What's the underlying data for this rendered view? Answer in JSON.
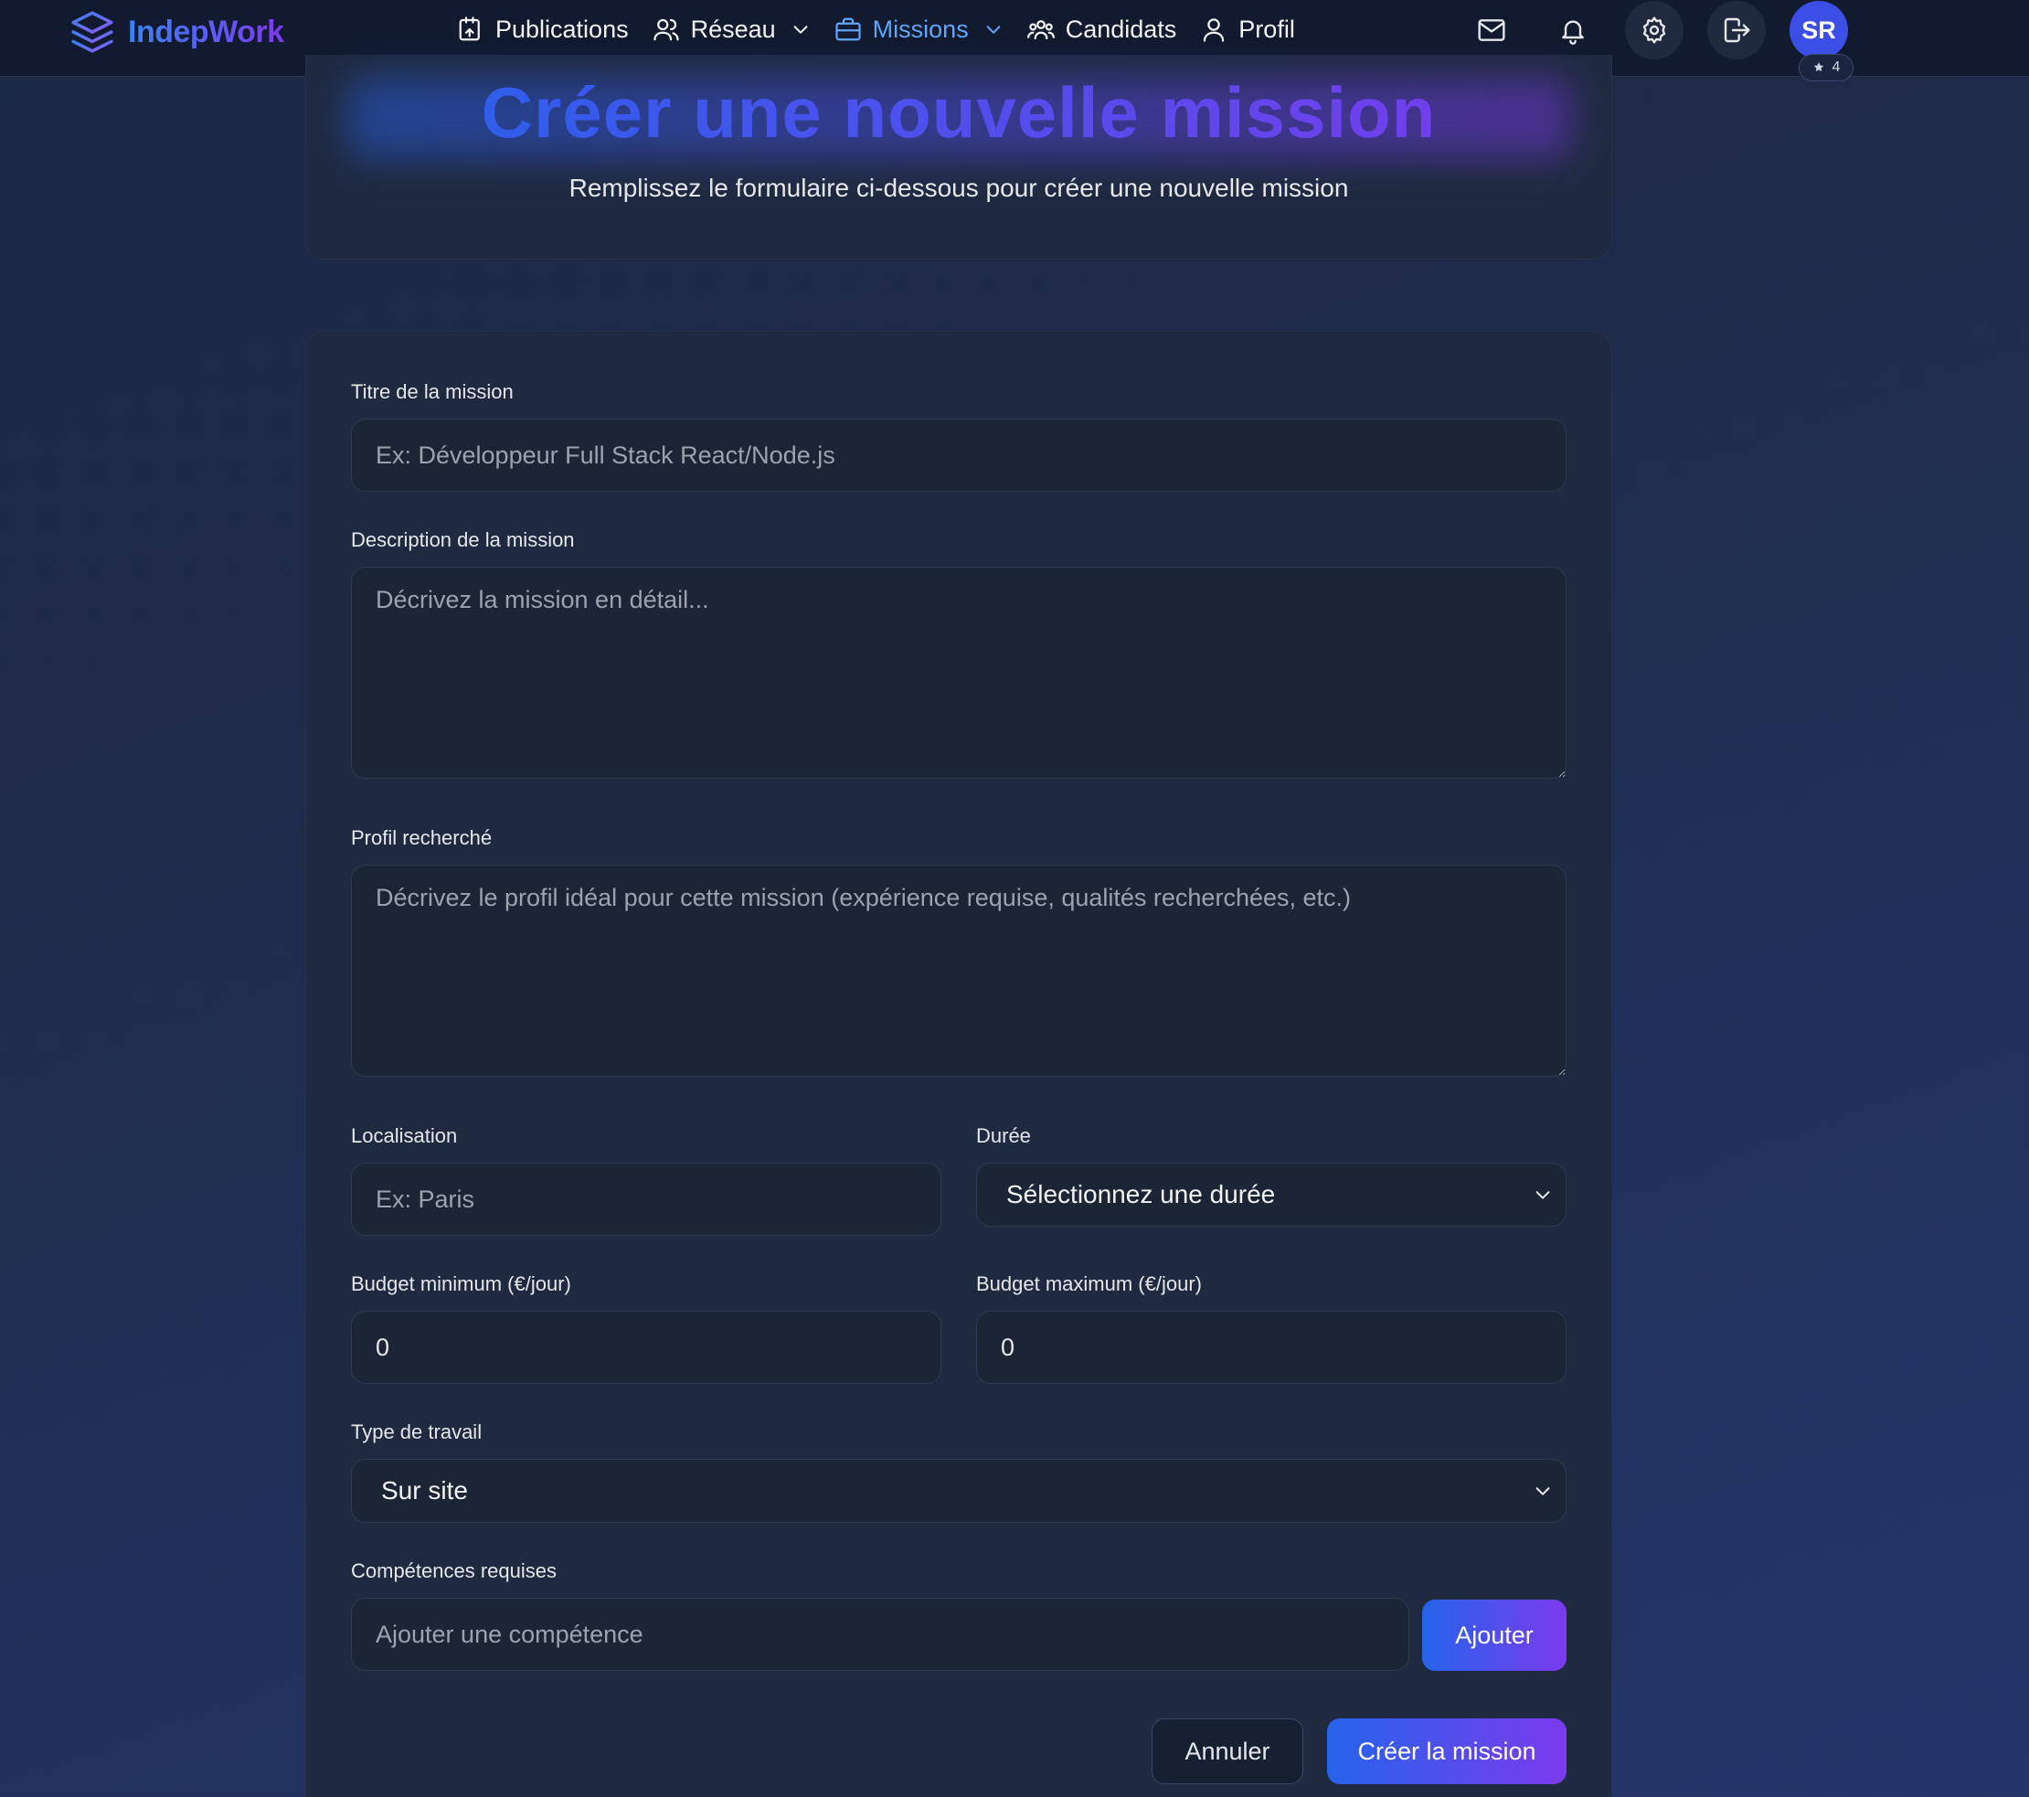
{
  "app": {
    "brand": "IndepWork"
  },
  "nav": {
    "items": [
      {
        "label": "Publications",
        "icon": "publications-icon"
      },
      {
        "label": "Réseau",
        "icon": "users-icon",
        "dropdown": true
      },
      {
        "label": "Missions",
        "icon": "briefcase-icon",
        "dropdown": true,
        "active": true
      },
      {
        "label": "Candidats",
        "icon": "group-icon"
      },
      {
        "label": "Profil",
        "icon": "user-icon"
      }
    ],
    "avatar_initials": "SR",
    "avatar_badge_count": "4"
  },
  "header": {
    "title": "Créer une nouvelle mission",
    "subtitle": "Remplissez le formulaire ci-dessous pour créer une nouvelle mission"
  },
  "form": {
    "title_label": "Titre de la mission",
    "title_placeholder": "Ex: Développeur Full Stack React/Node.js",
    "description_label": "Description de la mission",
    "description_placeholder": "Décrivez la mission en détail...",
    "profile_label": "Profil recherché",
    "profile_placeholder": "Décrivez le profil idéal pour cette mission (expérience requise, qualités recherchées, etc.)",
    "location_label": "Localisation",
    "location_placeholder": "Ex: Paris",
    "duration_label": "Durée",
    "duration_value": "Sélectionnez une durée",
    "budget_min_label": "Budget minimum (€/jour)",
    "budget_min_value": "0",
    "budget_max_label": "Budget maximum (€/jour)",
    "budget_max_value": "0",
    "work_type_label": "Type de travail",
    "work_type_value": "Sur site",
    "skills_label": "Compétences requises",
    "skills_placeholder": "Ajouter une compétence",
    "add_skill_label": "Ajouter",
    "cancel_label": "Annuler",
    "submit_label": "Créer la mission"
  },
  "colors": {
    "accent_start": "#2563eb",
    "accent_end": "#7c3aed",
    "active_nav": "#60a5fa",
    "navbar_bg": "#111a2e",
    "card_bg": "#1f2a40"
  }
}
